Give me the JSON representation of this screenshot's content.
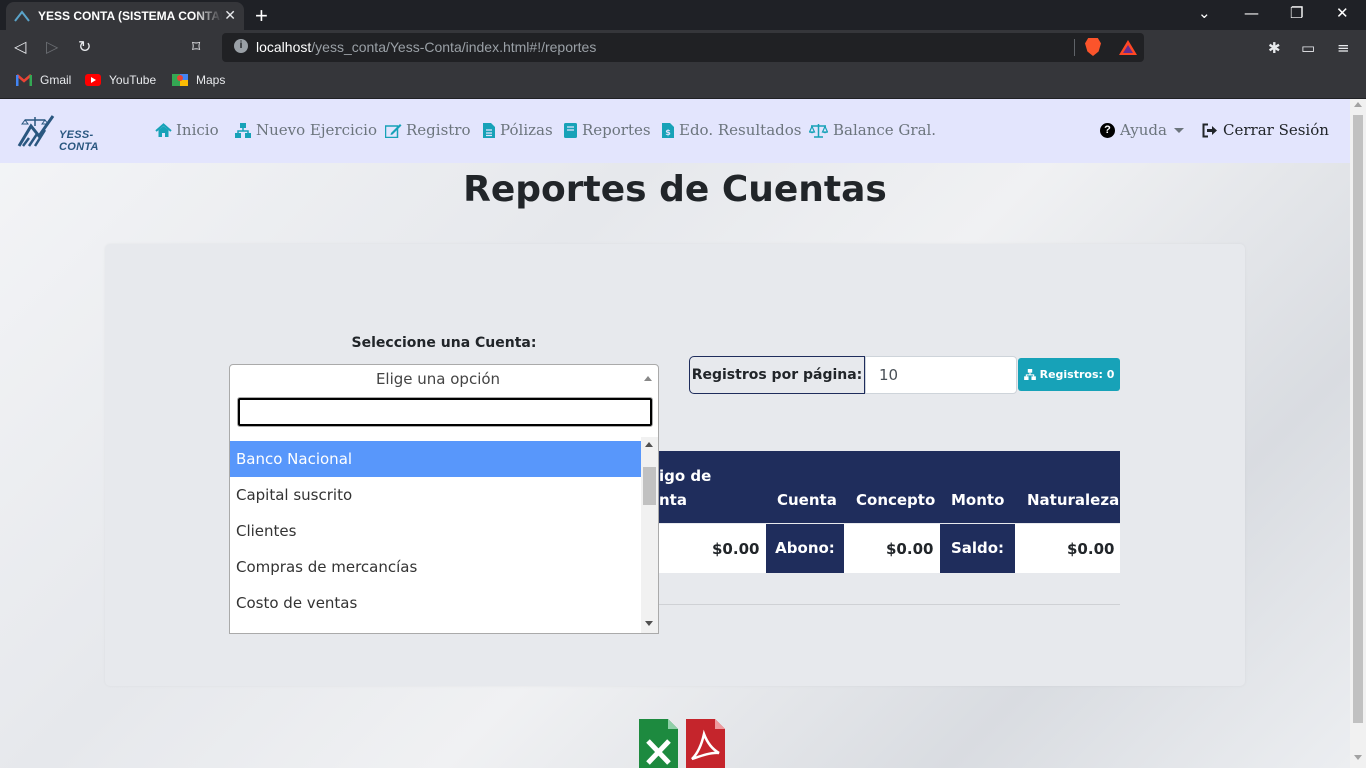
{
  "browser": {
    "tab_title": "YESS CONTA (SISTEMA CONTABLE)",
    "url_host": "localhost",
    "url_path": "/yess_conta/Yess-Conta/index.html#!/reportes",
    "bookmarks": [
      "Gmail",
      "YouTube",
      "Maps"
    ]
  },
  "navbar": {
    "brand": "YESS-CONTA",
    "items": [
      "Inicio",
      "Nuevo Ejercicio",
      "Registro",
      "Pólizas",
      "Reportes",
      "Edo. Resultados",
      "Balance Gral."
    ],
    "help": "Ayuda",
    "logout": "Cerrar Sesión"
  },
  "page": {
    "title": "Reportes de Cuentas"
  },
  "account_select": {
    "label": "Seleccione una Cuenta:",
    "placeholder": "Elige una opción",
    "search_value": "",
    "options": [
      "Banco Nacional",
      "Capital suscrito",
      "Clientes",
      "Compras de mercancías",
      "Costo de ventas"
    ],
    "highlighted": "Banco Nacional"
  },
  "pagination": {
    "label": "Registros por página:",
    "value": "10",
    "count_button": "Registros: 0"
  },
  "table": {
    "headers": [
      "Código de Cuenta",
      "Cuenta",
      "Concepto",
      "Monto",
      "Naturaleza"
    ],
    "visible_header_fragments": [
      "igo de",
      "nta"
    ],
    "totals": {
      "cargo_value": "$0.00",
      "abono_label": "Abono:",
      "abono_value": "$0.00",
      "saldo_label": "Saldo:",
      "saldo_value": "$0.00"
    }
  },
  "colors": {
    "navbar_bg": "#e3e5fd",
    "table_header": "#1f2d5c",
    "info_button": "#17a2b8",
    "highlight": "#5897fb",
    "excel": "#1d8a3f",
    "pdf": "#c5252c"
  },
  "icons": [
    "home-icon",
    "sitemap-icon",
    "edit-icon",
    "file-icon",
    "book-icon",
    "file-invoice-icon",
    "balance-scale-icon",
    "question-circle-icon",
    "sign-out-icon",
    "excel-icon",
    "pdf-icon"
  ]
}
